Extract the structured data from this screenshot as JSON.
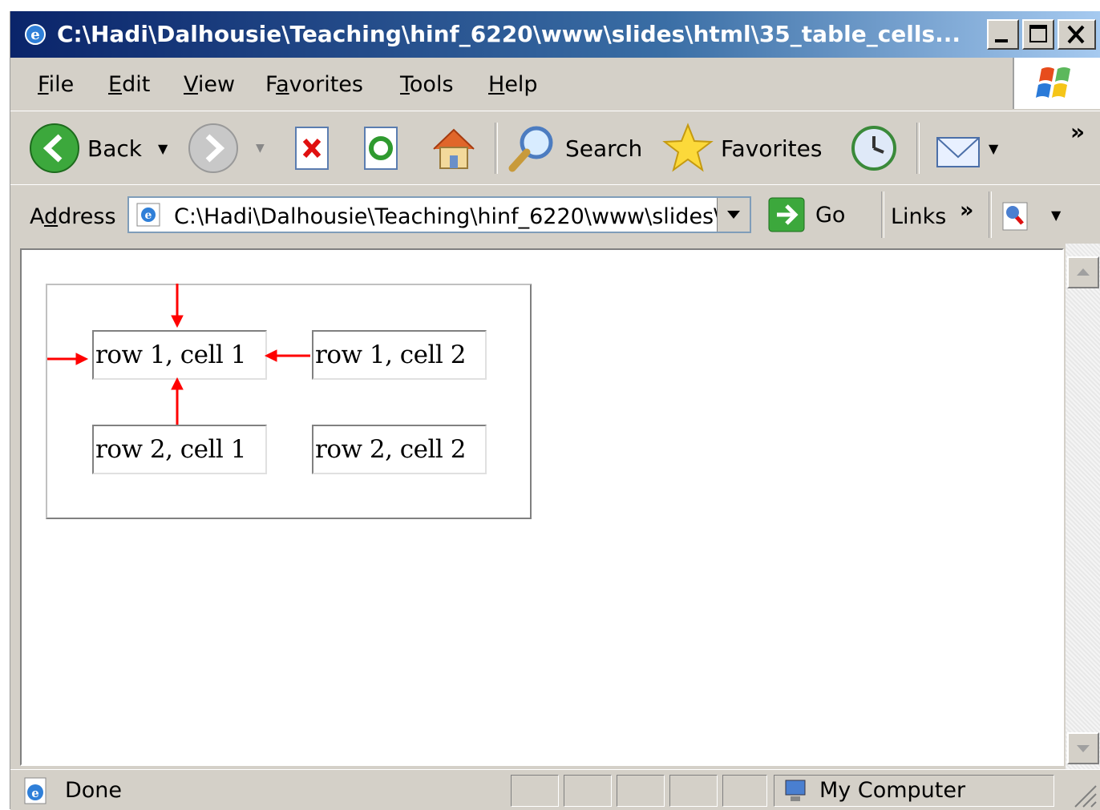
{
  "window": {
    "title": "C:\\Hadi\\Dalhousie\\Teaching\\hinf_6220\\www\\slides\\html\\35_table_cells..."
  },
  "menu": {
    "items": [
      {
        "label": "File",
        "accel": "F",
        "rest": "ile"
      },
      {
        "label": "Edit",
        "accel": "E",
        "rest": "dit"
      },
      {
        "label": "View",
        "accel": "V",
        "rest": "iew"
      },
      {
        "label": "Favorites",
        "pre": "F",
        "accel": "a",
        "rest": "vorites"
      },
      {
        "label": "Tools",
        "accel": "T",
        "rest": "ools"
      },
      {
        "label": "Help",
        "accel": "H",
        "rest": "elp"
      }
    ]
  },
  "toolbar": {
    "back_label": "Back",
    "search_label": "Search",
    "favorites_label": "Favorites",
    "overflow": "»"
  },
  "address": {
    "label_pre": "A",
    "label_accel": "d",
    "label_rest": "dress",
    "value": "C:\\Hadi\\Dalhousie\\Teaching\\hinf_6220\\www\\slides\\",
    "go_label": "Go",
    "links_label": "Links",
    "links_overflow": "»"
  },
  "page": {
    "table": [
      [
        "row 1, cell 1",
        "row 1, cell 2"
      ],
      [
        "row 2, cell 1",
        "row 2, cell 2"
      ]
    ],
    "annotation_color": "#ff0000"
  },
  "status": {
    "text": "Done",
    "zone": "My Computer"
  },
  "colors": {
    "titlebar_start": "#0a246a",
    "titlebar_end": "#a6caf0",
    "chrome": "#d4d0c8"
  }
}
